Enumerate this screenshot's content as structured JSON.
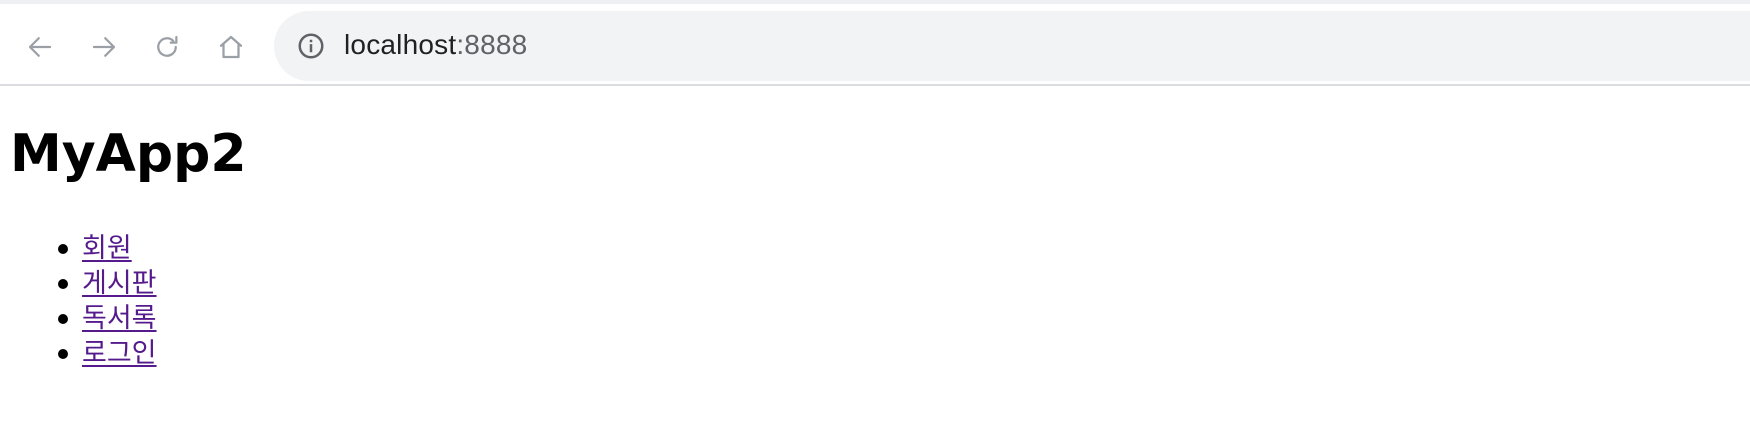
{
  "browser": {
    "url_host": "localhost",
    "url_port": ":8888",
    "icons": {
      "back": "arrow-left-icon",
      "forward": "arrow-right-icon",
      "reload": "reload-icon",
      "home": "home-icon",
      "site_info": "info-icon"
    }
  },
  "page": {
    "title": "MyApp2",
    "nav": [
      {
        "label": "회원"
      },
      {
        "label": "게시판"
      },
      {
        "label": "독서록"
      },
      {
        "label": "로그인"
      }
    ],
    "link_color": "#551a8b"
  }
}
